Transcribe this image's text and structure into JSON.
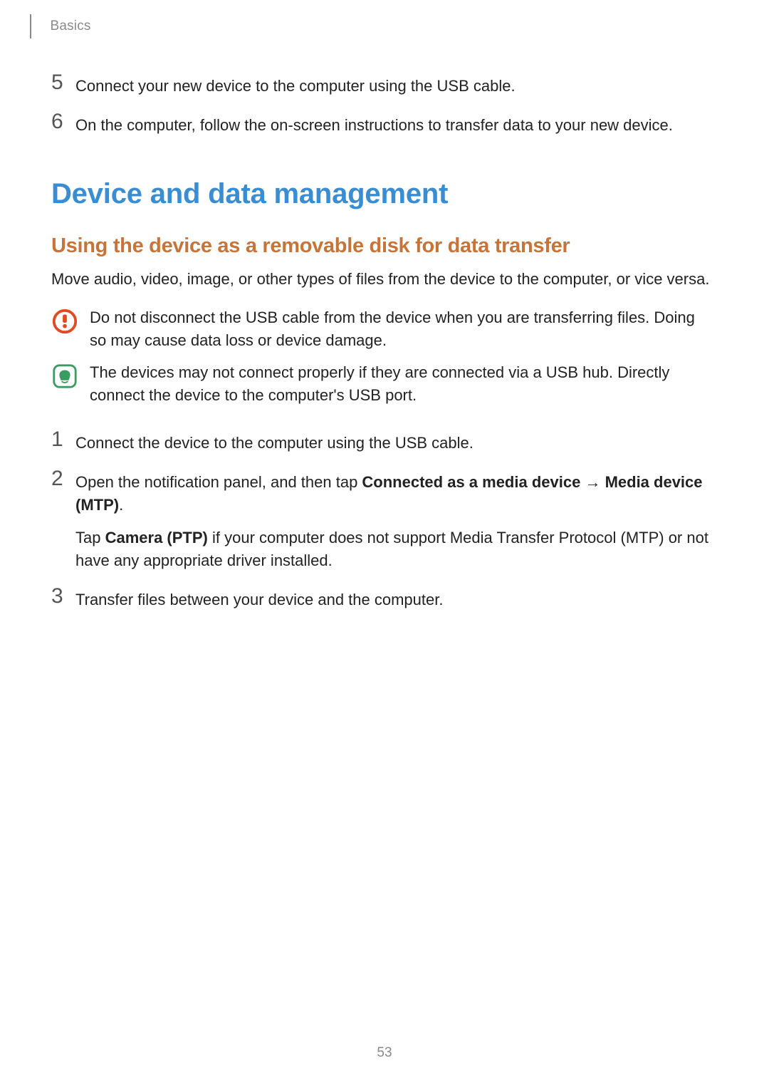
{
  "header": {
    "section": "Basics"
  },
  "steps_top": {
    "s5_num": "5",
    "s5_text": "Connect your new device to the computer using the USB cable.",
    "s6_num": "6",
    "s6_text": "On the computer, follow the on-screen instructions to transfer data to your new device."
  },
  "h1": "Device and data management",
  "h2": "Using the device as a removable disk for data transfer",
  "intro": "Move audio, video, image, or other types of files from the device to the computer, or vice versa.",
  "callouts": {
    "warn_text": "Do not disconnect the USB cable from the device when you are transferring files. Doing so may cause data loss or device damage.",
    "note_text": "The devices may not connect properly if they are connected via a USB hub. Directly connect the device to the computer's USB port."
  },
  "steps_main": {
    "s1_num": "1",
    "s1_text": "Connect the device to the computer using the USB cable.",
    "s2_num": "2",
    "s2_pre": "Open the notification panel, and then tap ",
    "s2_b1": "Connected as a media device",
    "s2_arrow": " → ",
    "s2_b2": "Media device (MTP)",
    "s2_post": ".",
    "s2_sub_pre": "Tap ",
    "s2_sub_b": "Camera (PTP)",
    "s2_sub_post": " if your computer does not support Media Transfer Protocol (MTP) or not have any appropriate driver installed.",
    "s3_num": "3",
    "s3_text": "Transfer files between your device and the computer."
  },
  "page_number": "53"
}
